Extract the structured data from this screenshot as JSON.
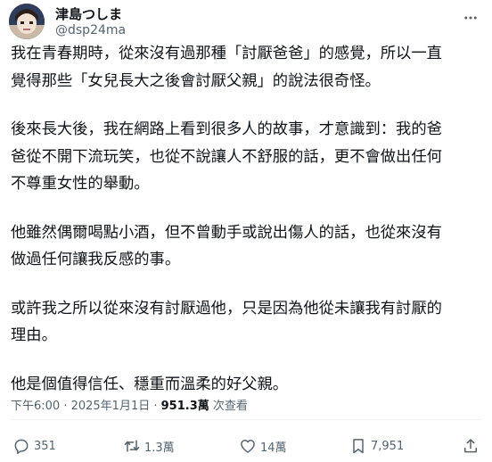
{
  "author": {
    "name": "津島つしま",
    "handle": "@dsp24ma"
  },
  "post": {
    "paragraphs": [
      "我在青春期時，從來沒有過那種「討厭爸爸」的感覺，所以一直\n覺得那些「女兒長大之後會討厭父親」的說法很奇怪。",
      "後來長大後，我在網路上看到很多人的故事，才意識到：我的爸\n爸從不開下流玩笑，也從不說讓人不舒服的話，更不會做出任何\n不尊重女性的舉動。",
      "他雖然偶爾喝點小酒，但不曾動手或說出傷人的話，也從來沒有\n做過任何讓我反感的事。",
      "或許我之所以從來沒有討厭過他，只是因為他從未讓我有討厭的\n理由。",
      "他是個值得信任、穩重而溫柔的好父親。"
    ],
    "timestamp": "下午6:00 · 2025年1月1日 · ",
    "views_count": "951.3萬",
    "views_label": " 次查看"
  },
  "actions": {
    "replies": "351",
    "reposts": "1.3萬",
    "likes": "14萬",
    "bookmarks": "7,951"
  },
  "icons": {
    "more": "more-horizontal-icon",
    "reply": "reply-icon",
    "repost": "repost-icon",
    "like": "heart-icon",
    "bookmark": "bookmark-icon",
    "share": "share-icon"
  }
}
